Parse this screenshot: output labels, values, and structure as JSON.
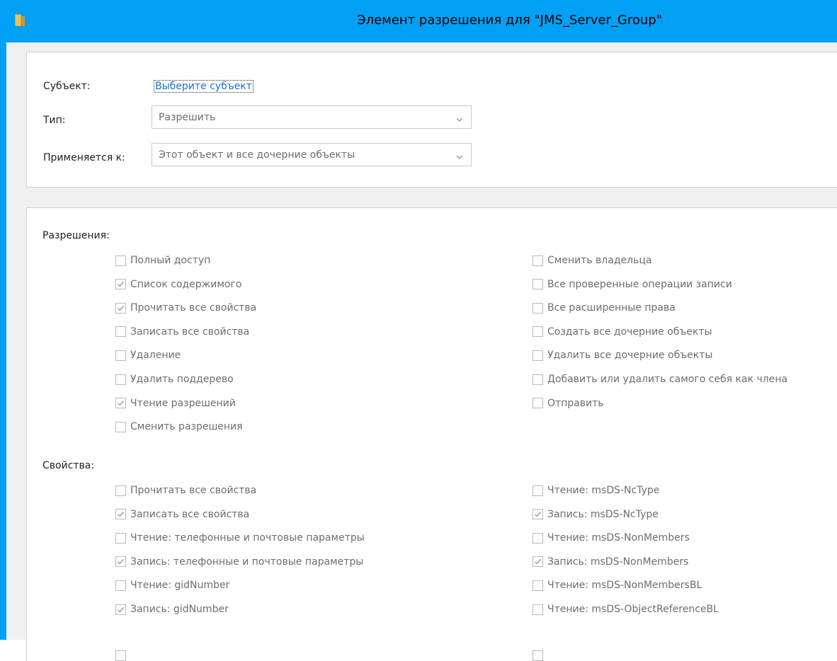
{
  "window": {
    "title": "Элемент разрешения для \"JMS_Server_Group\"",
    "accent_color": "#00a0f5",
    "icon": "folder-icon"
  },
  "principal": {
    "label": "Субъект:",
    "link": "Выберите субъект"
  },
  "type": {
    "label": "Тип:",
    "value": "Разрешить"
  },
  "applies_to": {
    "label": "Применяется к:",
    "value": "Этот объект и все дочерние объекты"
  },
  "permissions": {
    "title": "Разрешения:",
    "left": [
      {
        "label": "Полный доступ",
        "checked": false
      },
      {
        "label": "Список содержимого",
        "checked": true
      },
      {
        "label": "Прочитать все свойства",
        "checked": true
      },
      {
        "label": "Записать все свойства",
        "checked": false
      },
      {
        "label": "Удаление",
        "checked": false
      },
      {
        "label": "Удалить поддерево",
        "checked": false
      },
      {
        "label": "Чтение разрешений",
        "checked": true
      },
      {
        "label": "Сменить разрешения",
        "checked": false
      }
    ],
    "right": [
      {
        "label": "Сменить владельца",
        "checked": false
      },
      {
        "label": "Все проверенные операции записи",
        "checked": false
      },
      {
        "label": "Все расширенные права",
        "checked": false
      },
      {
        "label": "Создать все дочерние объекты",
        "checked": false
      },
      {
        "label": "Удалить все дочерние объекты",
        "checked": false
      },
      {
        "label": "Добавить или удалить самого себя как члена",
        "checked": false
      },
      {
        "label": "Отправить",
        "checked": false
      }
    ]
  },
  "properties": {
    "title": "Свойства:",
    "left": [
      {
        "label": "Прочитать все свойства",
        "checked": false
      },
      {
        "label": "Записать все свойства",
        "checked": true
      },
      {
        "label": "Чтение: телефонные и почтовые параметры",
        "checked": false
      },
      {
        "label": "Запись: телефонные и почтовые параметры",
        "checked": true
      },
      {
        "label": "Чтение: gidNumber",
        "checked": false
      },
      {
        "label": "Запись: gidNumber",
        "checked": true
      }
    ],
    "right": [
      {
        "label": "Чтение: msDS-NcType",
        "checked": false
      },
      {
        "label": "Запись: msDS-NcType",
        "checked": true
      },
      {
        "label": "Чтение: msDS-NonMembers",
        "checked": false
      },
      {
        "label": "Запись: msDS-NonMembers",
        "checked": true
      },
      {
        "label": "Чтение: msDS-NonMembersBL",
        "checked": false
      },
      {
        "label": "Чтение: msDS-ObjectReferenceBL",
        "checked": false
      }
    ]
  }
}
